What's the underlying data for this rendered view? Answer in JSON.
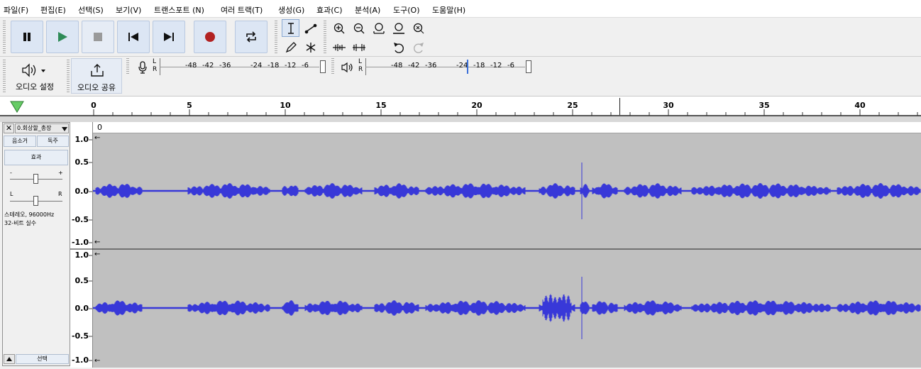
{
  "menu": [
    "파일(F)",
    "편집(E)",
    "선택(S)",
    "보기(V)",
    "트랜스포트 (N)",
    "여러 트랙(T)",
    "생성(G)",
    "효과(C)",
    "분석(A)",
    "도구(O)",
    "도움말(H)"
  ],
  "toolbar": {
    "icons": {
      "pause": "pause-icon",
      "play": "play-icon",
      "stop": "stop-icon",
      "skip_start": "skip-to-start-icon",
      "skip_end": "skip-to-end-icon",
      "record": "record-icon",
      "loop": "loop-icon"
    },
    "record_color": "#b22222",
    "play_color": "#2e8b57"
  },
  "audio_setup": {
    "label": "오디오 설정"
  },
  "audio_share": {
    "label": "오디오 공유"
  },
  "meters": {
    "record_ticks": [
      "-48",
      "-42",
      "-36",
      "-24",
      "-18",
      "-12",
      "-6"
    ],
    "play_ticks": [
      "-48",
      "-42",
      "-36",
      "-24",
      "-18",
      "-12",
      "-6"
    ],
    "channels": [
      "L",
      "R"
    ]
  },
  "timeline": {
    "labels": [
      "0",
      "5",
      "10",
      "15",
      "20",
      "25",
      "30",
      "35",
      "40"
    ]
  },
  "track": {
    "name": "0.회상할_총장",
    "mute": "음소거",
    "solo": "독주",
    "effects": "효과",
    "gain_minus": "-",
    "gain_plus": "+",
    "pan_left": "L",
    "pan_right": "R",
    "info_line1": "스테레오, 96000Hz",
    "info_line2": "32-비트 실수",
    "select": "선택",
    "clip_label": "0",
    "scale": [
      "1.0",
      "0.5",
      "0.0",
      "-0.5",
      "-1.0"
    ]
  },
  "waveform_color": "#3838d8"
}
